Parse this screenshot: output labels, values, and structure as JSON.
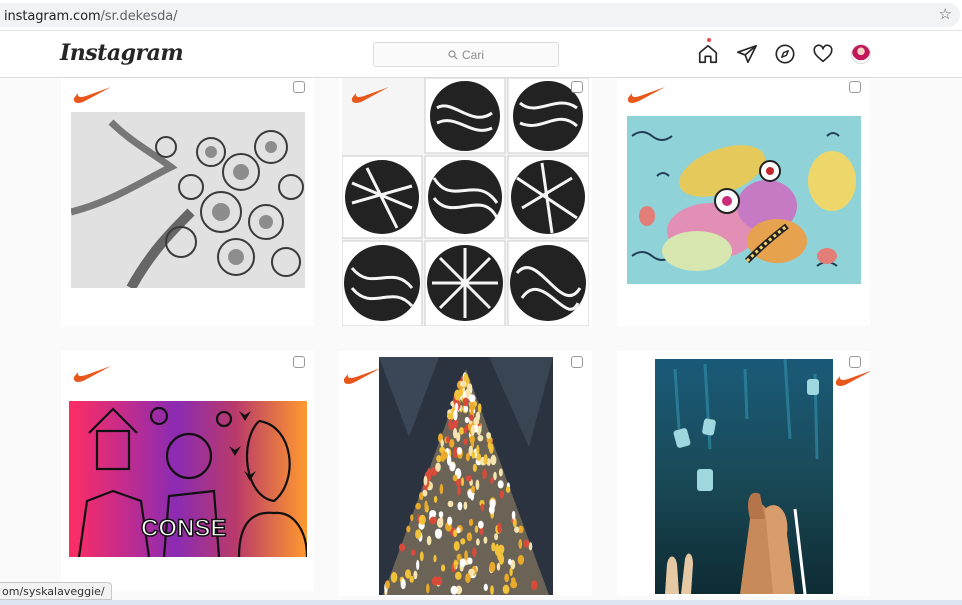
{
  "browser": {
    "url_host": "instagram.com",
    "url_path": "/sr.dekesda/",
    "status_url": "om/syskalaveggie/"
  },
  "header": {
    "logo": "Instagram",
    "search_placeholder": "Cari",
    "nav_icons": [
      "home-icon",
      "direct-icon",
      "explore-icon",
      "activity-icon",
      "profile-avatar"
    ]
  },
  "colors": {
    "accent_red": "#ed4956",
    "swoosh_orange": "#e8571c"
  },
  "posts": [
    {
      "id": "post-1",
      "subject": "tree-pencil-drawing"
    },
    {
      "id": "post-2",
      "subject": "zentangle-circles"
    },
    {
      "id": "post-3",
      "subject": "colorful-animals"
    },
    {
      "id": "post-4",
      "subject": "purple-orange-poster"
    },
    {
      "id": "post-5",
      "subject": "crowd-pyramid"
    },
    {
      "id": "post-6",
      "subject": "praying-hands-masks"
    }
  ]
}
